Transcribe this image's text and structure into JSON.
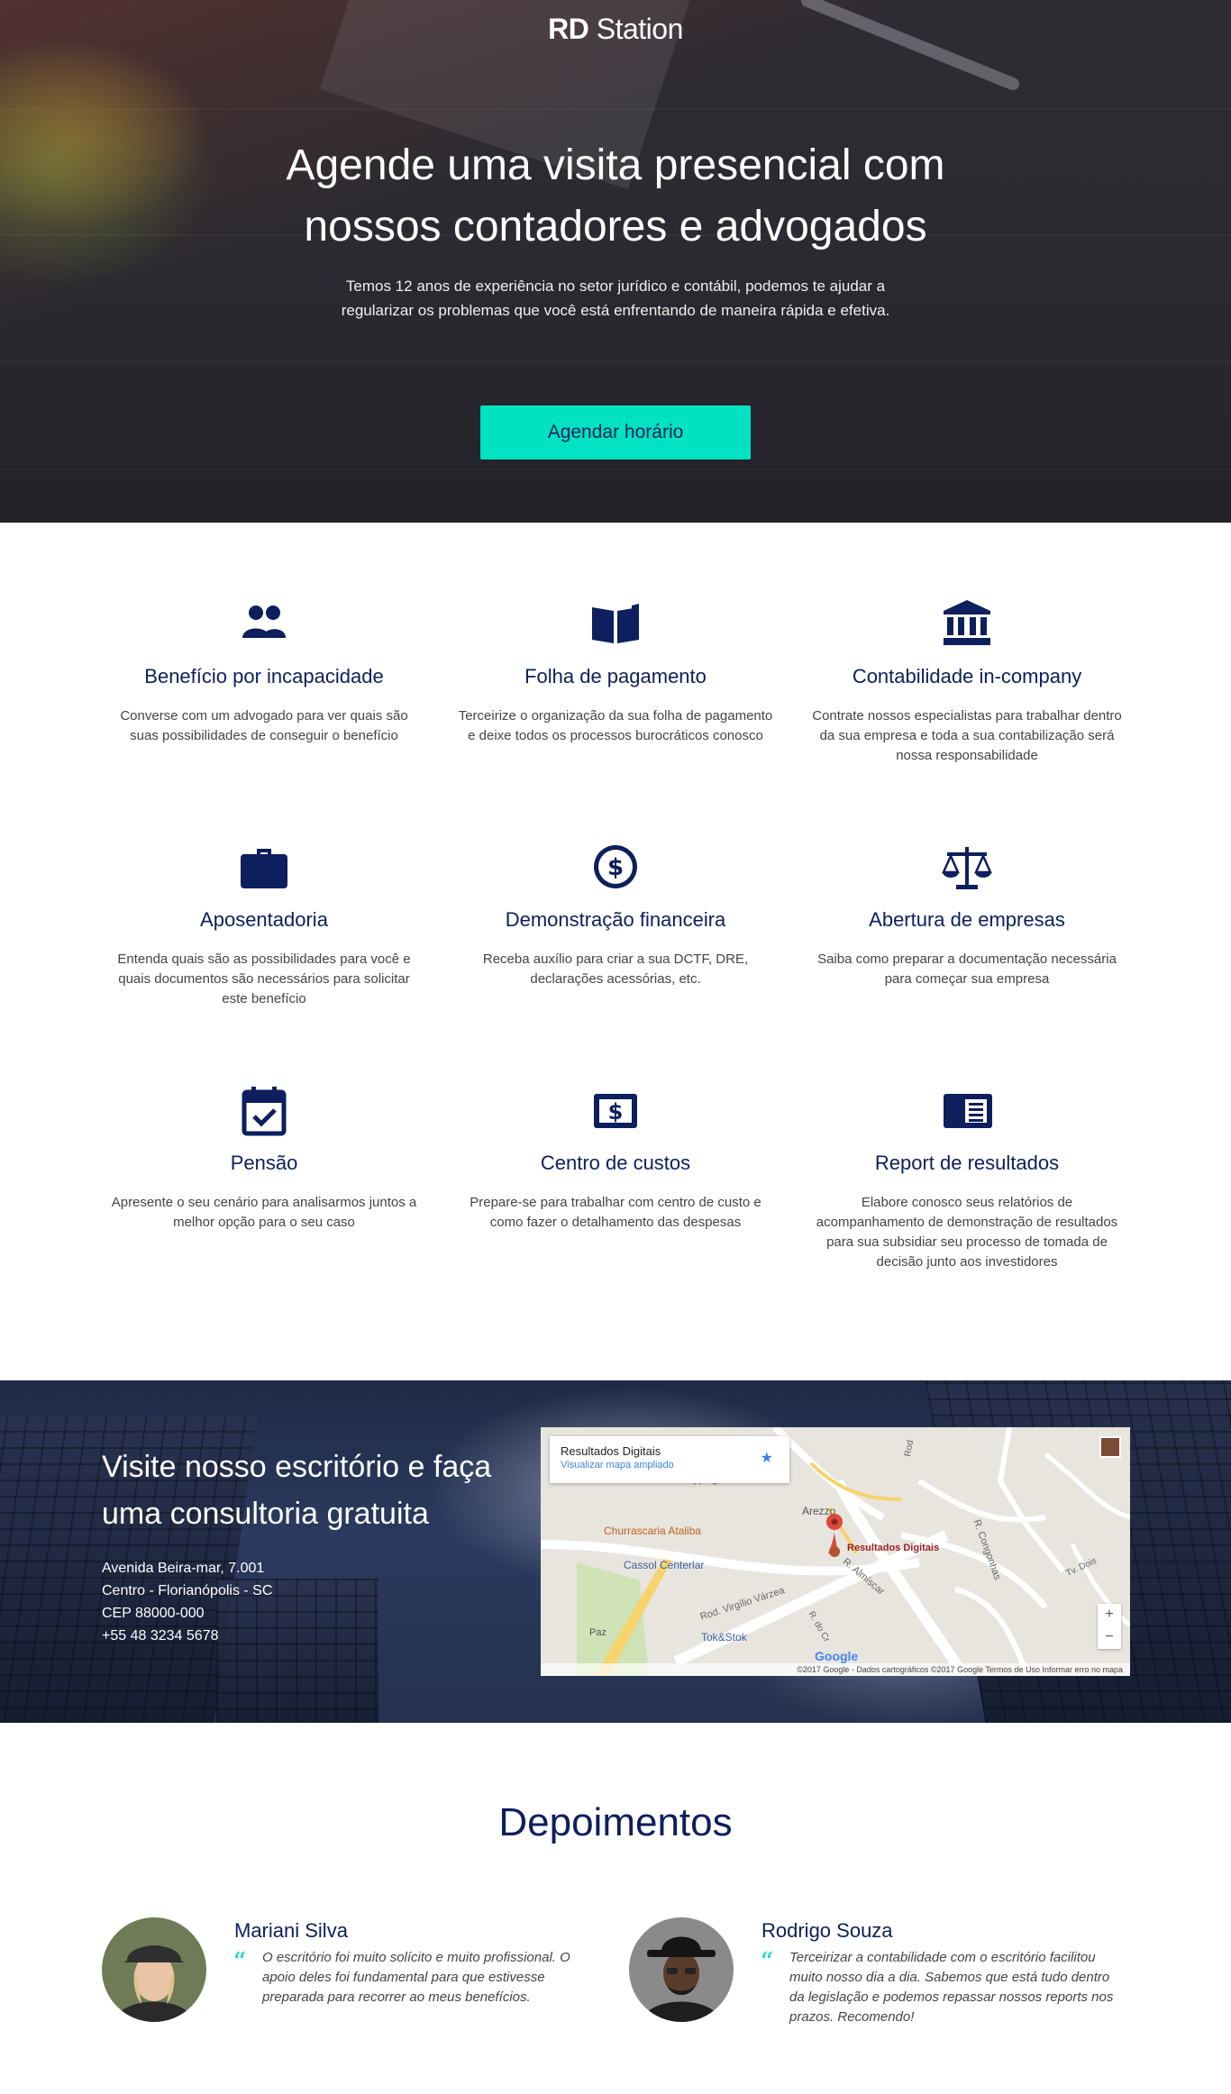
{
  "brand": {
    "logo_bold": "RD",
    "logo_light": " Station"
  },
  "hero": {
    "title_line1": "Agende uma visita presencial com",
    "title_line2": "nossos contadores e advogados",
    "subtitle": "Temos 12 anos de experiência no setor jurídico e contábil, podemos te ajudar a regularizar os problemas que você está enfrentando de maneira rápida e efetiva.",
    "cta_label": "Agendar horário"
  },
  "services": [
    {
      "icon": "users-icon",
      "title": "Benefício por incapacidade",
      "text": "Converse com um advogado para ver quais são suas possibilidades de conseguir o benefício"
    },
    {
      "icon": "book-icon",
      "title": "Folha de pagamento",
      "text": "Terceirize o organização da sua folha de pagamento e deixe todos os processos burocráticos conosco"
    },
    {
      "icon": "bank-icon",
      "title": "Contabilidade in-company",
      "text": "Contrate nossos especialistas para trabalhar dentro da sua empresa e toda a sua contabilização será nossa responsabilidade"
    },
    {
      "icon": "briefcase-icon",
      "title": "Aposentadoria",
      "text": "Entenda quais são as possibilidades para você e quais documentos são necessários para solicitar este benefício"
    },
    {
      "icon": "dollar-circle-icon",
      "title": "Demonstração financeira",
      "text": "Receba auxílio para criar a sua DCTF, DRE, declarações acessórias, etc."
    },
    {
      "icon": "scales-icon",
      "title": "Abertura de empresas",
      "text": "Saiba como preparar a documentação necessária para começar sua empresa"
    },
    {
      "icon": "calendar-check-icon",
      "title": "Pensão",
      "text": "Apresente o seu cenário para analisarmos juntos a melhor opção para o seu caso"
    },
    {
      "icon": "money-bill-icon",
      "title": "Centro de custos",
      "text": "Prepare-se para trabalhar com centro de custo e como fazer o detalhamento das despesas"
    },
    {
      "icon": "newspaper-icon",
      "title": "Report de resultados",
      "text": "Elabore conosco seus relatórios de acompanhamento de demonstração de resultados para sua subsidiar seu processo de tomada de decisão junto aos investidores"
    }
  ],
  "visit": {
    "title": "Visite nosso escritório e faça uma consultoria gratuita",
    "address_line1": "Avenida Beira-mar, 7.001",
    "address_line2": "Centro - Florianópolis - SC",
    "address_line3": "CEP 88000-000",
    "phone": "+55 48 3234 5678"
  },
  "map": {
    "place_name": "Resultados Digitais",
    "enlarge_link": "Visualizar mapa ampliado",
    "marker_label": "Resultados Digitais",
    "places": [
      "Churrascaria Ataliba",
      "Cassol Centerlar",
      "Arezzo",
      "Tok&Stok",
      "Shopping",
      "Paz"
    ],
    "streets": [
      "Rod. Virgílio Várzea",
      "R. Almíscar",
      "R. Congonhas",
      "Tv. Dois",
      "R. do Cr",
      "Rod"
    ],
    "zoom_in": "+",
    "zoom_out": "−",
    "google": "Google",
    "attribution": "©2017 Google - Dados cartográficos ©2017 Google    Termos de Uso    Informar erro no mapa"
  },
  "testimonials": {
    "heading": "Depoimentos",
    "items": [
      {
        "name": "Mariani Silva",
        "quote": "O escritório foi muito solícito e muito profissional. O apoio deles foi fundamental para que estivesse preparada para recorrer ao meus benefícios."
      },
      {
        "name": "Rodrigo Souza",
        "quote": "Terceirizar a contabilidade com o escritório facilitou muito nosso dia a dia. Sabemos que está tudo dentro da legislação e podemos repassar nossos reports nos prazos. Recomendo!"
      }
    ]
  },
  "colors": {
    "accent": "#00e2c1",
    "navy": "#0d1f5c"
  }
}
